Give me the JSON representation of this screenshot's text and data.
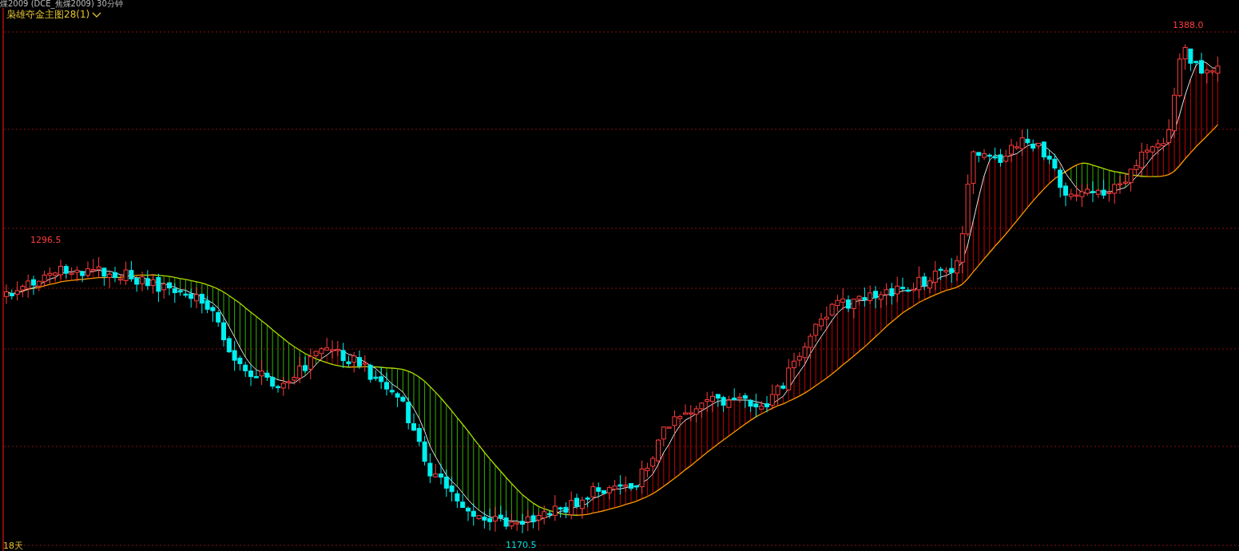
{
  "header": {
    "title": "煤2009 (DCE_焦煤2009) 30分钟"
  },
  "indicator": {
    "label": "枭雄夺金主图28(1)"
  },
  "chart": {
    "labels": [
      {
        "kind": "high",
        "text": "1388.0"
      },
      {
        "kind": "high",
        "text": "1296.5"
      },
      {
        "kind": "low",
        "text": "1170.5"
      }
    ],
    "period_label": "18天"
  }
}
